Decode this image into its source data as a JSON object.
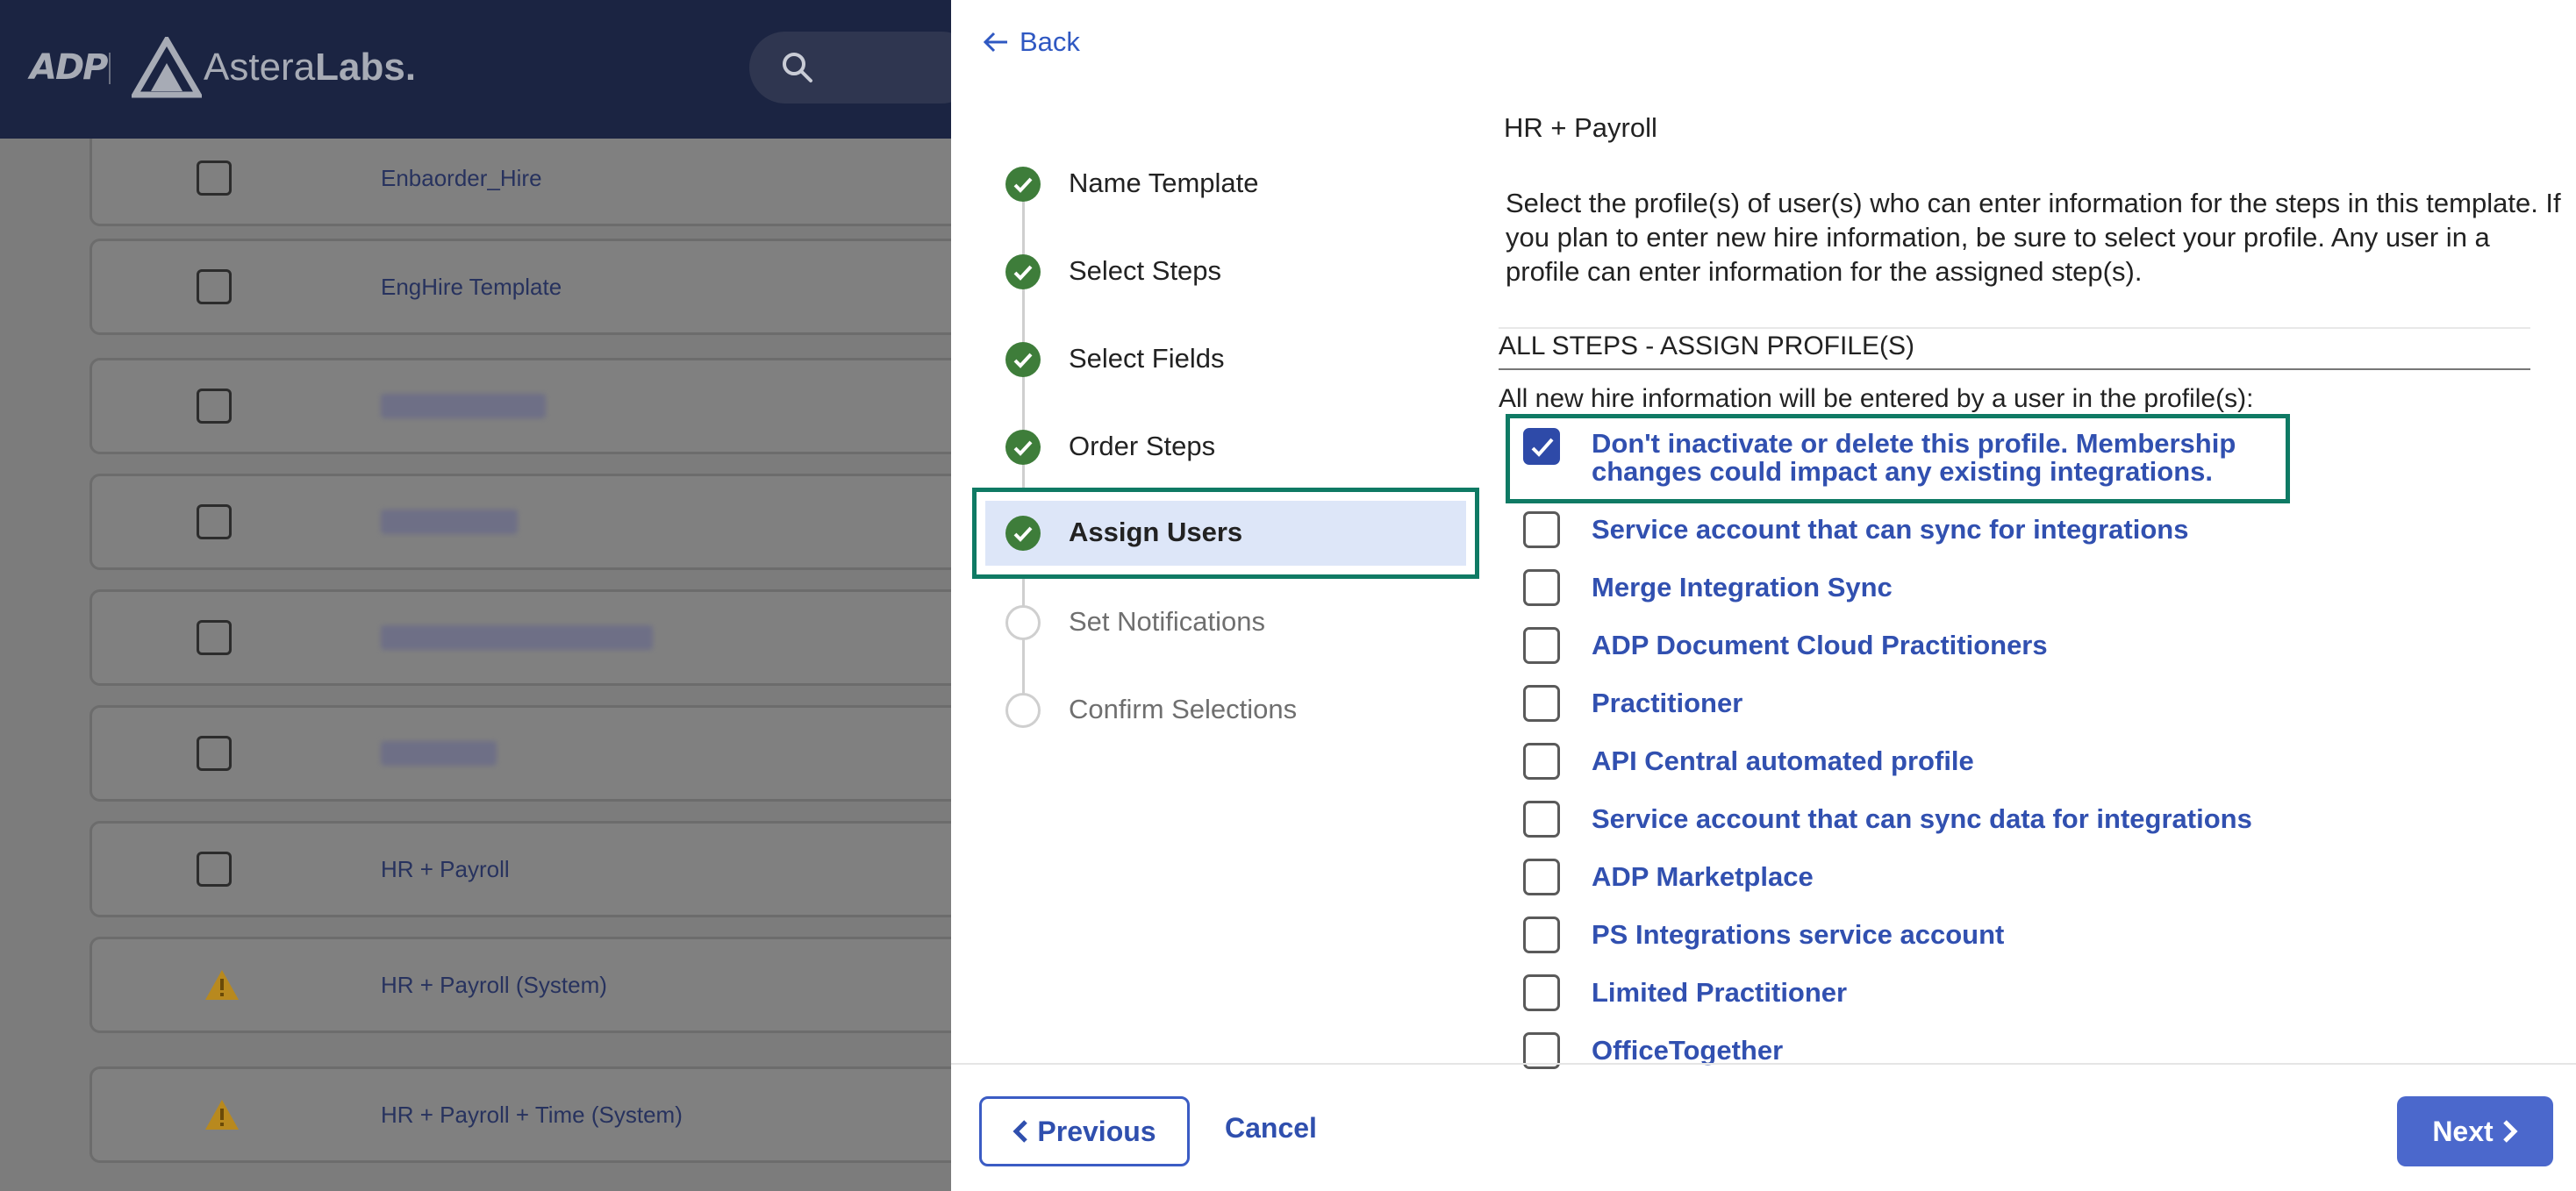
{
  "header": {
    "logo_adp": "ADP",
    "logo_brand_light": "Astera",
    "logo_brand_bold": "Labs."
  },
  "background_list": {
    "rows": [
      {
        "label": "Enbaorder_Hire",
        "marker": "checkbox"
      },
      {
        "label": "EngHire Template",
        "marker": "checkbox"
      },
      {
        "label": "",
        "marker": "checkbox",
        "blurred": true
      },
      {
        "label": "",
        "marker": "checkbox",
        "blurred": true
      },
      {
        "label": "",
        "marker": "checkbox",
        "blurred": true
      },
      {
        "label": "",
        "marker": "checkbox",
        "blurred": true
      },
      {
        "label": "HR + Payroll",
        "marker": "checkbox"
      },
      {
        "label": "HR + Payroll (System)",
        "marker": "warning-icon"
      },
      {
        "label": "HR + Payroll + Time (System)",
        "marker": "warning-icon"
      }
    ]
  },
  "drawer": {
    "back_label": "Back",
    "steps": [
      {
        "label": "Name Template",
        "status": "done"
      },
      {
        "label": "Select Steps",
        "status": "done"
      },
      {
        "label": "Select Fields",
        "status": "done"
      },
      {
        "label": "Order Steps",
        "status": "done"
      },
      {
        "label": "Assign Users",
        "status": "active"
      },
      {
        "label": "Set Notifications",
        "status": "pending"
      },
      {
        "label": "Confirm Selections",
        "status": "pending"
      }
    ],
    "template_name": "HR + Payroll",
    "description": "Select the profile(s) of user(s) who can enter information for the steps in this template. If you plan to enter new hire information, be sure to select your profile. Any user in a profile can enter information for the assigned step(s).",
    "section_title": "ALL STEPS - ASSIGN PROFILE(S)",
    "section_hint": "All new hire information will be entered by a user in the profile(s):",
    "profiles": [
      {
        "label": "Don't inactivate or delete this profile. Membership changes could impact any existing integrations.",
        "checked": true
      },
      {
        "label": "Service account that can sync for integrations",
        "checked": false
      },
      {
        "label": "Merge Integration Sync",
        "checked": false
      },
      {
        "label": "ADP Document Cloud Practitioners",
        "checked": false
      },
      {
        "label": "Practitioner",
        "checked": false
      },
      {
        "label": "API Central automated profile",
        "checked": false
      },
      {
        "label": "Service account that can sync data for integrations",
        "checked": false
      },
      {
        "label": "ADP Marketplace",
        "checked": false
      },
      {
        "label": "PS Integrations service account",
        "checked": false
      },
      {
        "label": "Limited Practitioner",
        "checked": false
      },
      {
        "label": "OfficeTogether",
        "checked": false
      }
    ],
    "footer": {
      "previous_label": "Previous",
      "cancel_label": "Cancel",
      "next_label": "Next"
    }
  },
  "colors": {
    "accent": "#3150b0",
    "success": "#3e7d3a",
    "focus_outline": "#0f7a64",
    "topbar": "#1b2442"
  }
}
